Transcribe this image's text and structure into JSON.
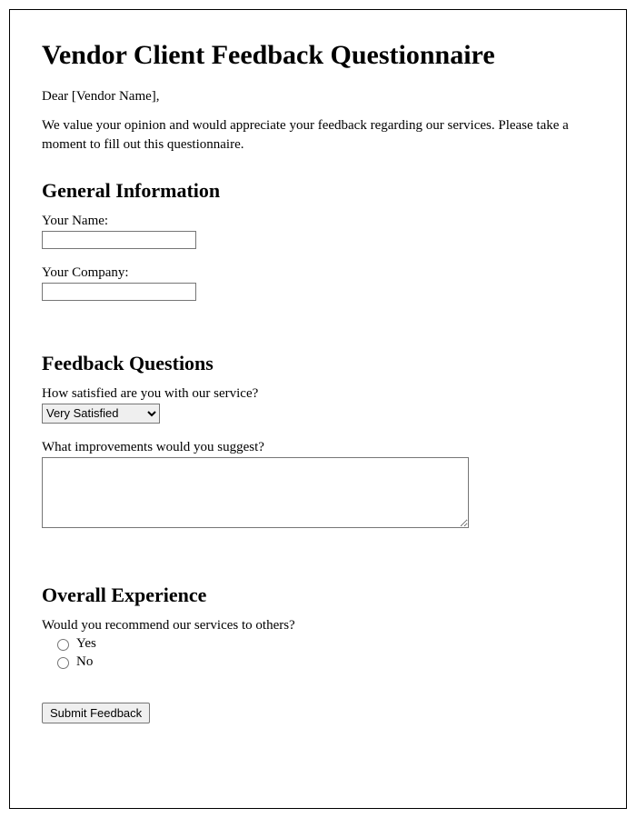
{
  "title": "Vendor Client Feedback Questionnaire",
  "greeting": "Dear [Vendor Name],",
  "intro": "We value your opinion and would appreciate your feedback regarding our services. Please take a moment to fill out this questionnaire.",
  "sections": {
    "general": {
      "heading": "General Information",
      "name_label": "Your Name:",
      "company_label": "Your Company:"
    },
    "feedback": {
      "heading": "Feedback Questions",
      "satisfaction_label": "How satisfied are you with our service?",
      "satisfaction_selected": "Very Satisfied",
      "improvements_label": "What improvements would you suggest?"
    },
    "overall": {
      "heading": "Overall Experience",
      "recommend_label": "Would you recommend our services to others?",
      "yes_label": "Yes",
      "no_label": "No"
    }
  },
  "submit_label": "Submit Feedback"
}
